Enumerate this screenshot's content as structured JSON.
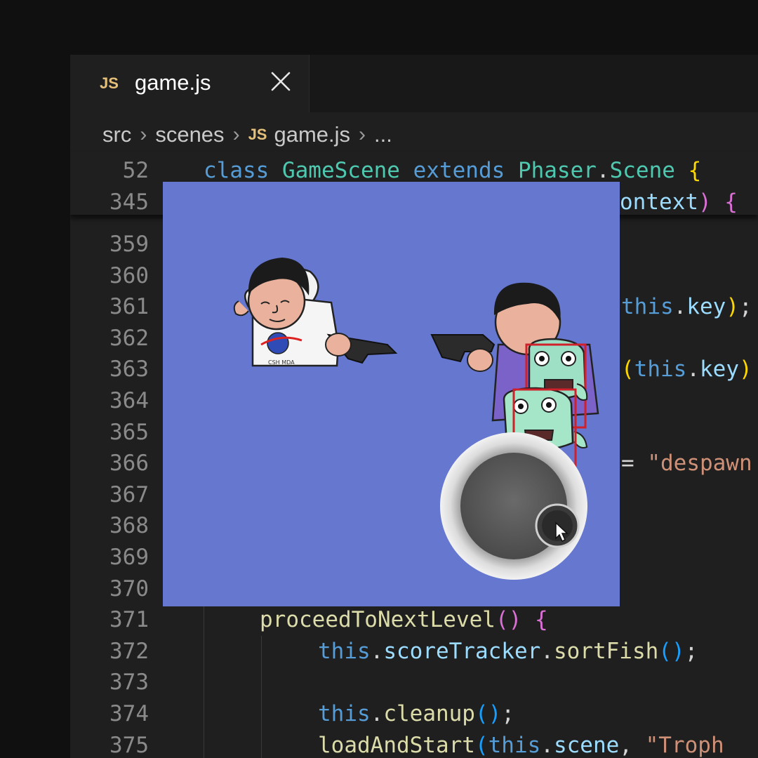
{
  "tab": {
    "icon": "JS",
    "filename": "game.js",
    "close_icon": "close-icon"
  },
  "breadcrumb": {
    "items": [
      "src",
      "scenes"
    ],
    "file_icon": "JS",
    "file": "game.js",
    "more": "..."
  },
  "sticky": [
    {
      "num": "52",
      "tokens": [
        [
          "kw",
          "class "
        ],
        [
          "cls",
          "GameScene "
        ],
        [
          "kw",
          "extends "
        ],
        [
          "cls",
          "Phaser"
        ],
        [
          "pl",
          "."
        ],
        [
          "cls",
          "Scene "
        ],
        [
          "br1",
          "{"
        ]
      ]
    },
    {
      "num": "345",
      "tokens": [
        [
          "prop",
          "ontext"
        ],
        [
          "br2",
          ") {"
        ]
      ]
    }
  ],
  "lines": [
    {
      "num": "359",
      "tokens": []
    },
    {
      "num": "360",
      "tokens": []
    },
    {
      "num": "361",
      "tokens": [
        [
          "kw",
          "this"
        ],
        [
          "pl",
          "."
        ],
        [
          "prop",
          "key"
        ],
        [
          "br1",
          ")"
        ],
        [
          "pl",
          ";"
        ]
      ]
    },
    {
      "num": "362",
      "tokens": []
    },
    {
      "num": "363",
      "tokens": [
        [
          "br1",
          "("
        ],
        [
          "kw",
          "this"
        ],
        [
          "pl",
          "."
        ],
        [
          "prop",
          "key"
        ],
        [
          "br1",
          ")"
        ]
      ]
    },
    {
      "num": "364",
      "tokens": []
    },
    {
      "num": "365",
      "tokens": []
    },
    {
      "num": "366",
      "tokens": [
        [
          "pl",
          "= "
        ],
        [
          "str",
          "\"despawn"
        ]
      ]
    },
    {
      "num": "367",
      "tokens": []
    },
    {
      "num": "368",
      "tokens": []
    },
    {
      "num": "369",
      "tokens": []
    },
    {
      "num": "370",
      "tokens": []
    },
    {
      "num": "371",
      "tokens": [
        [
          "fn",
          "proceedToNextLevel"
        ],
        [
          "br2",
          "() "
        ],
        [
          "br2",
          "{"
        ]
      ]
    },
    {
      "num": "372",
      "tokens": [
        [
          "kw",
          "this"
        ],
        [
          "pl",
          "."
        ],
        [
          "prop",
          "scoreTracker"
        ],
        [
          "pl",
          "."
        ],
        [
          "fn",
          "sortFish"
        ],
        [
          "br3",
          "()"
        ],
        [
          "pl",
          ";"
        ]
      ]
    },
    {
      "num": "373",
      "tokens": []
    },
    {
      "num": "374",
      "tokens": [
        [
          "kw",
          "this"
        ],
        [
          "pl",
          "."
        ],
        [
          "fn",
          "cleanup"
        ],
        [
          "br3",
          "()"
        ],
        [
          "pl",
          ";"
        ]
      ]
    },
    {
      "num": "375",
      "tokens": [
        [
          "fn",
          "loadAndStart"
        ],
        [
          "br3",
          "("
        ],
        [
          "kw",
          "this"
        ],
        [
          "pl",
          "."
        ],
        [
          "prop",
          "scene"
        ],
        [
          "pl",
          ", "
        ],
        [
          "str",
          "\"Troph"
        ]
      ]
    }
  ],
  "game": {
    "background": "#6577cf",
    "shirt_text": "CSH MDA",
    "joystick": "virtual joystick",
    "cursor_icon": "cursor-icon"
  }
}
